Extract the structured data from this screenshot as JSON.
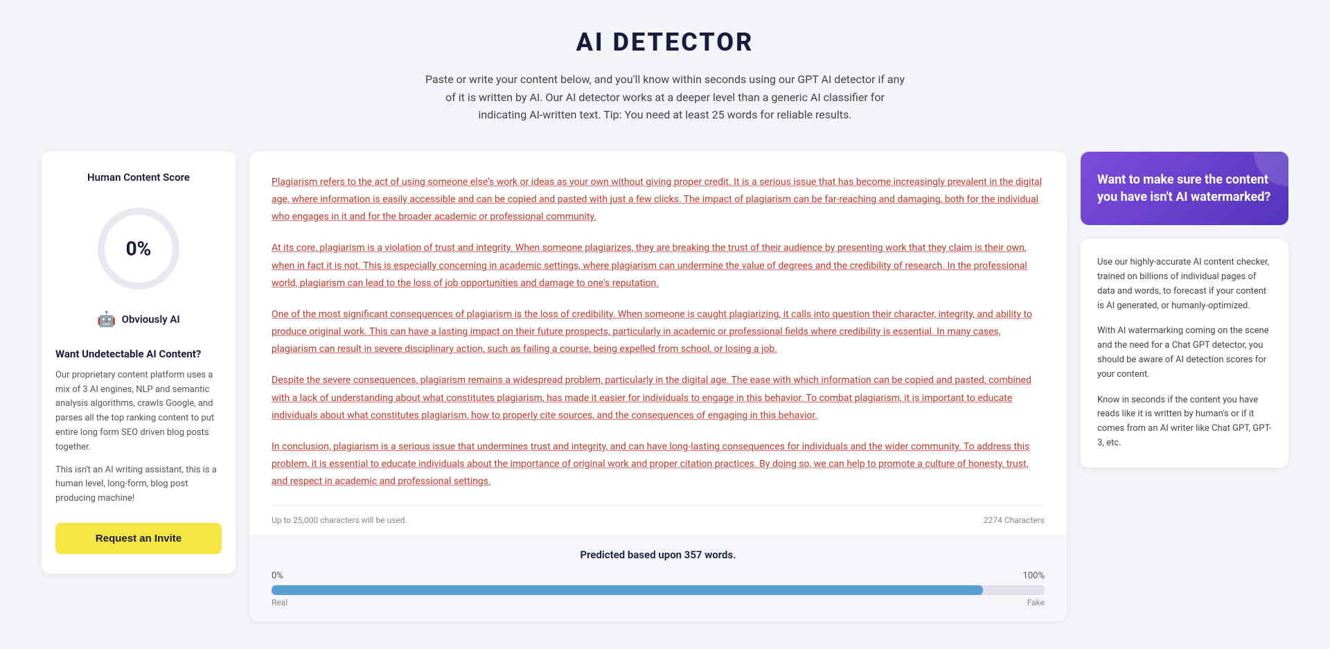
{
  "header": {
    "title": "AI DETECTOR",
    "description": "Paste or write your content below, and you'll know within seconds using our GPT AI detector if any of it is written by AI. Our AI detector works at a deeper level than a generic AI classifier for indicating AI-written text. Tip: You need at least 25 words for reliable results."
  },
  "leftPanel": {
    "scoreTitle": "Human Content Score",
    "scoreValue": "0%",
    "scoreLabel": "Obviously AI",
    "wantTitle": "Want Undetectable AI Content?",
    "desc1": "Our proprietary content platform uses a mix of 3 AI engines, NLP and semantic analysis algorithms, crawls Google, and parses all the top ranking content to put entire long form SEO driven blog posts together.",
    "desc2": "This isn't an AI writing assistant, this is a human level, long-form, blog post producing machine!",
    "buttonLabel": "Request an Invite"
  },
  "centerPanel": {
    "paragraphs": [
      "Plagiarism refers to the act of using someone else's work or ideas as your own without giving proper credit. It is a serious issue that has become increasingly prevalent in the digital age, where information is easily accessible and can be copied and pasted with just a few clicks. The impact of plagiarism can be far-reaching and damaging, both for the individual who engages in it and for the broader academic or professional community.",
      "At its core, plagiarism is a violation of trust and integrity. When someone plagiarizes, they are breaking the trust of their audience by presenting work that they claim is their own, when in fact it is not. This is especially concerning in academic settings, where plagiarism can undermine the value of degrees and the credibility of research. In the professional world, plagiarism can lead to the loss of job opportunities and damage to one's reputation.",
      "One of the most significant consequences of plagiarism is the loss of credibility. When someone is caught plagiarizing, it calls into question their character, integrity, and ability to produce original work. This can have a lasting impact on their future prospects, particularly in academic or professional fields where credibility is essential. In many cases, plagiarism can result in severe disciplinary action, such as failing a course, being expelled from school, or losing a job.",
      "Despite the severe consequences, plagiarism remains a widespread problem, particularly in the digital age. The ease with which information can be copied and pasted, combined with a lack of understanding about what constitutes plagiarism, has made it easier for individuals to engage in this behavior. To combat plagiarism, it is important to educate individuals about what constitutes plagiarism, how to properly cite sources, and the consequences of engaging in this behavior.",
      "In conclusion, plagiarism is a serious issue that undermines trust and integrity, and can have long-lasting consequences for individuals and the wider community. To address this problem, it is essential to educate individuals about the importance of original work and proper citation practices. By doing so, we can help to promote a culture of honesty, trust, and respect in academic and professional settings."
    ],
    "bottomLeft": "Up to 25,000 characters will be used.",
    "bottomRight": "2274 Characters",
    "predictionTitle": "Predicted based upon 357 words.",
    "barLabel0": "0%",
    "barLabelReal": "Real",
    "barLabel100": "100%",
    "barLabelFake": "Fake"
  },
  "rightPanel": {
    "purpleCardTitle": "Want to make sure the content you have isn't AI watermarked?",
    "infoLine1": "Use our highly-accurate AI content checker, trained on billions of individual pages of data and words, to forecast if your content is AI generated, or humanly-optimized.",
    "infoLine2": "With AI watermarking coming on the scene and the need for a Chat GPT detector, you should be aware of AI detection scores for your content.",
    "infoLine3": "Know in seconds if the content you have reads like it is written by human's or if it comes from an AI writer like Chat GPT, GPT-3, etc."
  }
}
